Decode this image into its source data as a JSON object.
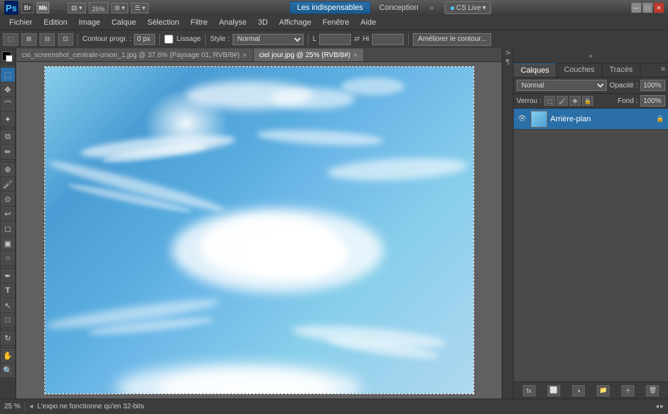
{
  "titlebar": {
    "zoom_label": "25%",
    "workspace_btn": "Les indispensables",
    "conception_btn": "Conception",
    "extend_btn": "»",
    "cs_live_btn": "CS Live",
    "minimize_btn": "—",
    "maximize_btn": "□",
    "close_btn": "✕"
  },
  "menubar": {
    "items": [
      {
        "label": "Fichier"
      },
      {
        "label": "Edition"
      },
      {
        "label": "Image"
      },
      {
        "label": "Calque"
      },
      {
        "label": "Sélection"
      },
      {
        "label": "Filtre"
      },
      {
        "label": "Analyse"
      },
      {
        "label": "3D"
      },
      {
        "label": "Affichage"
      },
      {
        "label": "Fenêtre"
      },
      {
        "label": "Aide"
      }
    ]
  },
  "options_bar": {
    "contour_label": "Contour progr. :",
    "px_value": "0 px",
    "lissage_label": "Lissage",
    "style_label": "Style :",
    "style_value": "Normal",
    "l_label": "L",
    "hi_label": "Hi",
    "ameliorer_btn": "Améliorer le contour..."
  },
  "tabs": [
    {
      "label": "cxi_screenshot_centrale-union_1.jpg @ 37,6% (Paysage 01, RVB/8#)",
      "active": false
    },
    {
      "label": "ciel jour.jpg @ 25% (RVB/8#)",
      "active": true
    }
  ],
  "panels": {
    "calques_tab": "Calques",
    "couches_tab": "Couches",
    "traces_tab": "Tracés",
    "blend_mode": "Normal",
    "opacity_label": "Opacité :",
    "opacity_value": "100%",
    "verrou_label": "Verrou :",
    "fill_label": "Fond :",
    "fill_value": "100%",
    "layers": [
      {
        "name": "Arrière-plan",
        "active": true,
        "visible": true,
        "locked": true
      }
    ],
    "bottom_icons": [
      "fx",
      "⬜",
      "🎨",
      "📁",
      "🗑"
    ]
  },
  "statusbar": {
    "zoom": "25 %",
    "info": "L'expo ne fonctionne qu'en 32-bits"
  },
  "tools": [
    {
      "name": "selection-rect",
      "symbol": "⬚"
    },
    {
      "name": "move",
      "symbol": "✥"
    },
    {
      "name": "lasso",
      "symbol": "⌒"
    },
    {
      "name": "magic-wand",
      "symbol": "✦"
    },
    {
      "name": "crop",
      "symbol": "⧉"
    },
    {
      "name": "eyedropper",
      "symbol": "✏"
    },
    {
      "name": "heal",
      "symbol": "⊕"
    },
    {
      "name": "brush",
      "symbol": "🖌"
    },
    {
      "name": "clone",
      "symbol": "⊙"
    },
    {
      "name": "history-brush",
      "symbol": "↩"
    },
    {
      "name": "eraser",
      "symbol": "◻"
    },
    {
      "name": "gradient",
      "symbol": "▣"
    },
    {
      "name": "dodge",
      "symbol": "○"
    },
    {
      "name": "pen",
      "symbol": "✒"
    },
    {
      "name": "text",
      "symbol": "T"
    },
    {
      "name": "path-selection",
      "symbol": "↖"
    },
    {
      "name": "shape",
      "symbol": "□"
    },
    {
      "name": "3d-rotate",
      "symbol": "↻"
    },
    {
      "name": "hand",
      "symbol": "✋"
    },
    {
      "name": "zoom-tool",
      "symbol": "🔍"
    }
  ]
}
